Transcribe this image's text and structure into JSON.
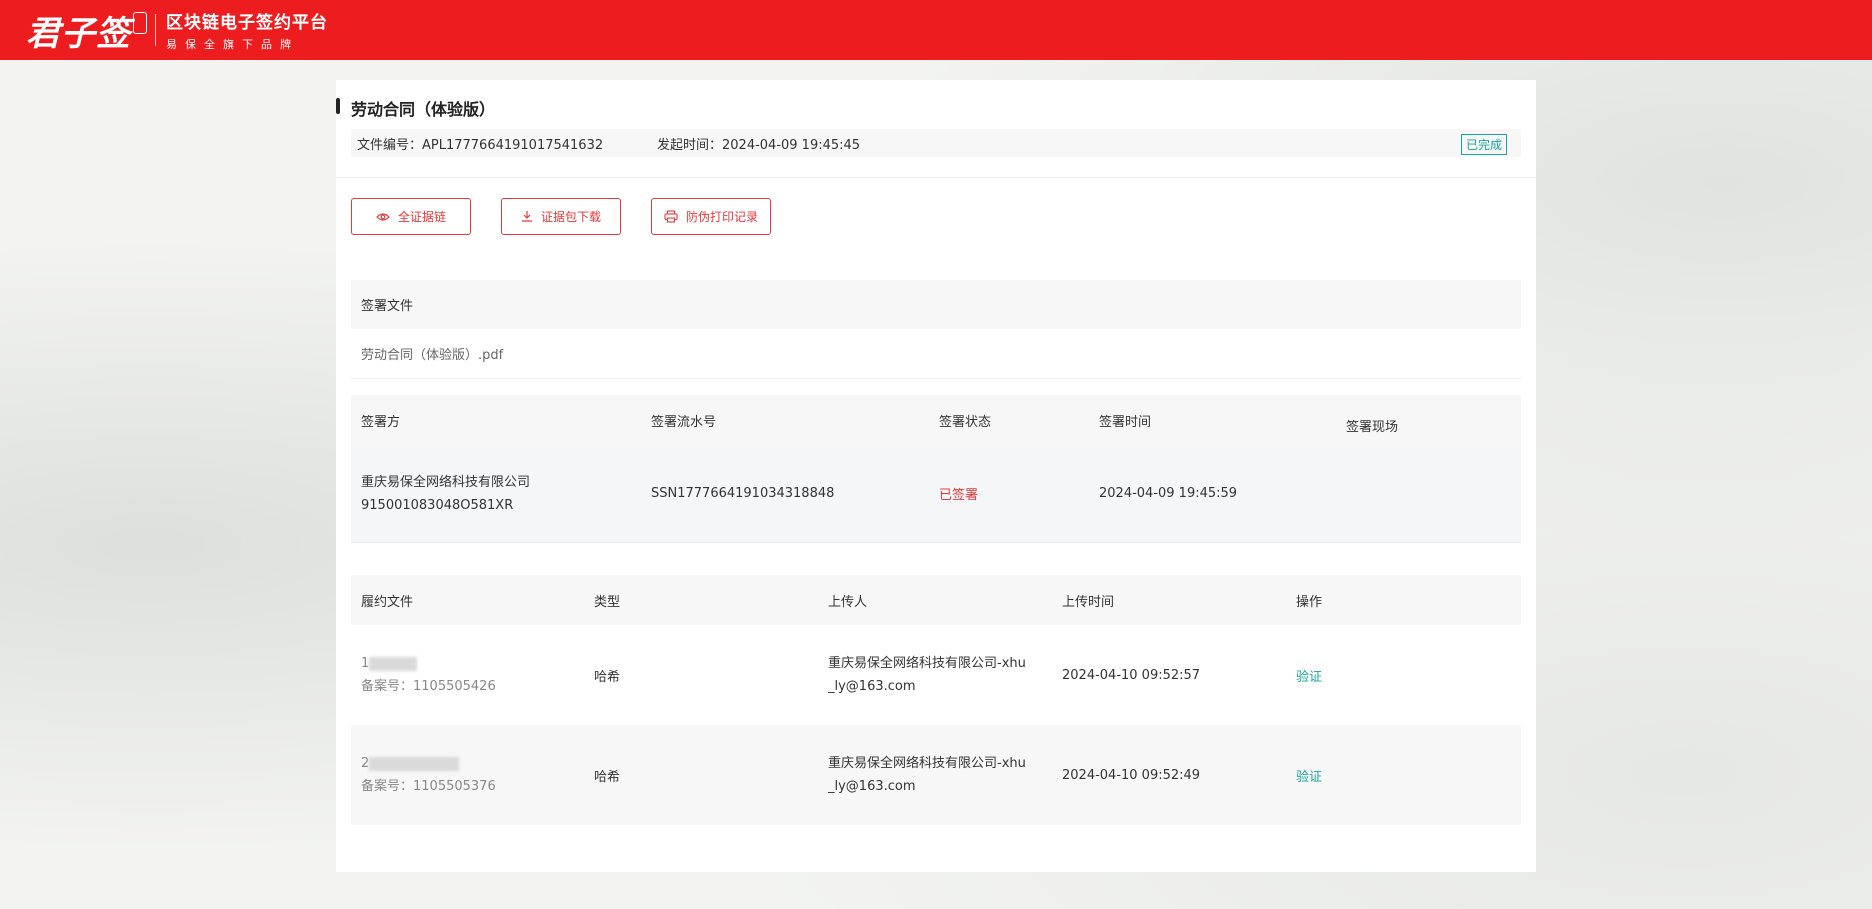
{
  "header": {
    "brand": "君子签",
    "platform_title": "区块链电子签约平台",
    "platform_sub": "易保全旗下品牌"
  },
  "contract": {
    "title": "劳动合同（体验版）",
    "doc_no": "文件编号：APL1777664191017541632",
    "start_time": "发起时间：2024-04-09 19:45:45",
    "status": "已完成"
  },
  "actions": {
    "evidence_chain": "全证据链",
    "download_pack": "证据包下载",
    "anti_fake_print": "防伪打印记录"
  },
  "sign_files": {
    "header": "签署文件",
    "file_name": "劳动合同（体验版）.pdf"
  },
  "signers": {
    "columns": [
      "签署方",
      "签署流水号",
      "签署状态",
      "签署时间",
      "签署现场"
    ],
    "rows": [
      {
        "party": "重庆易保全网络科技有限公司",
        "party_id": "915001083048O581XR",
        "serial": "SSN1777664191034318848",
        "status": "已签署",
        "time": "2024-04-09 19:45:59",
        "site": ""
      }
    ]
  },
  "perf_files": {
    "columns": [
      "履约文件",
      "类型",
      "上传人",
      "上传时间",
      "操作"
    ],
    "rows": [
      {
        "file_prefix": "1",
        "record": "备案号：1105505426",
        "type": "哈希",
        "uploader_l1": "重庆易保全网络科技有限公司-xhu",
        "uploader_l2": "_ly@163.com",
        "time": "2024-04-10 09:52:57",
        "action": "验证"
      },
      {
        "file_prefix": "2",
        "record": "备案号：1105505376",
        "type": "哈希",
        "uploader_l1": "重庆易保全网络科技有限公司-xhu",
        "uploader_l2": "_ly@163.com",
        "time": "2024-04-10 09:52:49",
        "action": "验证"
      }
    ]
  },
  "colors": {
    "brand_red": "#ec1c1f",
    "accent_teal": "#1aa59c"
  }
}
